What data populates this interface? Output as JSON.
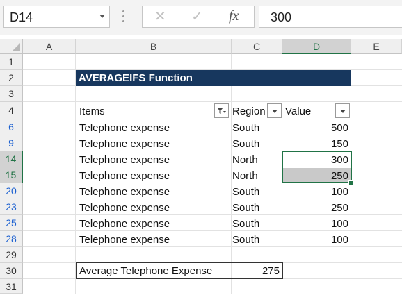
{
  "name_box": {
    "value": "D14"
  },
  "formula_bar": {
    "cancel_icon": "✕",
    "enter_icon": "✓",
    "fx_label": "fx",
    "value": "300"
  },
  "columns": [
    "A",
    "B",
    "C",
    "D",
    "E"
  ],
  "rows": [
    "1",
    "2",
    "3",
    "4",
    "6",
    "9",
    "14",
    "15",
    "20",
    "23",
    "25",
    "28",
    "29",
    "30",
    "31"
  ],
  "title": "AVERAGEIFS Function",
  "headers": {
    "items": "Items",
    "region": "Region",
    "value": "Value"
  },
  "data_rows": [
    {
      "row": "6",
      "item": "Telephone expense",
      "region": "South",
      "value": "500"
    },
    {
      "row": "9",
      "item": "Telephone expense",
      "region": "South",
      "value": "150"
    },
    {
      "row": "14",
      "item": "Telephone expense",
      "region": "North",
      "value": "300"
    },
    {
      "row": "15",
      "item": "Telephone expense",
      "region": "North",
      "value": "250"
    },
    {
      "row": "20",
      "item": "Telephone expense",
      "region": "South",
      "value": "100"
    },
    {
      "row": "23",
      "item": "Telephone expense",
      "region": "South",
      "value": "250"
    },
    {
      "row": "25",
      "item": "Telephone expense",
      "region": "South",
      "value": "100"
    },
    {
      "row": "28",
      "item": "Telephone expense",
      "region": "South",
      "value": "100"
    }
  ],
  "average": {
    "label": "Average Telephone Expense",
    "value": "275"
  },
  "colors": {
    "title_bg": "#17375e",
    "selection": "#217346",
    "filtered_row_number": "#1a5fd0"
  }
}
